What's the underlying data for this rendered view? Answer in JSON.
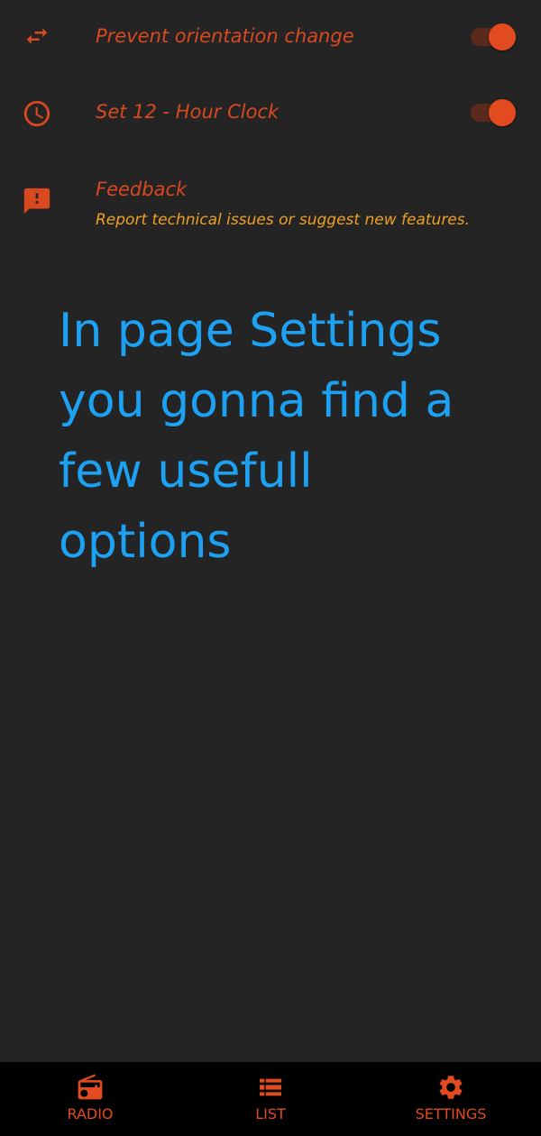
{
  "settings": {
    "items": [
      {
        "icon": "swap-arrows-icon",
        "title": "Prevent orientation change",
        "toggle_on": true
      },
      {
        "icon": "clock-icon",
        "title": "Set 12 - Hour Clock",
        "toggle_on": true
      },
      {
        "icon": "feedback-icon",
        "title": "Feedback",
        "subtitle": "Report technical issues or suggest new features."
      }
    ]
  },
  "overlay": {
    "text": "In page Settings you gonna find a few usefull options"
  },
  "bottom_nav": {
    "items": [
      {
        "label": "RADIO",
        "icon": "radio-icon"
      },
      {
        "label": "LIST",
        "icon": "list-icon"
      },
      {
        "label": "SETTINGS",
        "icon": "gear-icon"
      }
    ]
  },
  "colors": {
    "background": "#242424",
    "accent": "#e24a1f",
    "subtitle": "#f0a020",
    "overlay_text": "#1da1f2",
    "nav_background": "#000000"
  }
}
